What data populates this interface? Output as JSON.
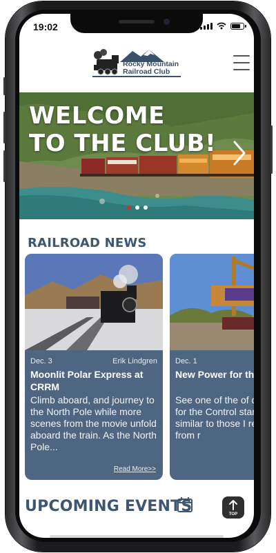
{
  "status_bar": {
    "time": "19:02"
  },
  "header": {
    "logo_line1": "Rocky Mountain",
    "logo_line2": "Railroad Club",
    "menu_icon": "hamburger-icon"
  },
  "hero": {
    "title_line1": "WELCOME",
    "title_line2": "TO THE CLUB!",
    "slide_count": 3,
    "active_slide": 1
  },
  "news": {
    "heading": "RAILROAD NEWS",
    "items": [
      {
        "date": "Dec. 3",
        "author": "Erik Lindgren",
        "title": "Moonlit Polar Express at CRRM",
        "excerpt": "Climb aboard, and journey to the North Pole while more scenes from the movie unfold aboard the train. As the North Pole...",
        "read_more": "Read More>>"
      },
      {
        "date": "Dec. 1",
        "author": "",
        "title": "New Power for the Durango & Silver",
        "excerpt": "See one of the of diesels for for the Control stand is v similar to those I remember from r",
        "read_more": ""
      }
    ]
  },
  "events": {
    "heading": "UPCOMING EVENTS",
    "calendar_icon": "calendar-icon"
  },
  "scroll_top": {
    "label": "TOP"
  },
  "colors": {
    "brand_blue": "#3f5670",
    "card_blue": "#4f6683",
    "dot_active": "#c0392b"
  }
}
